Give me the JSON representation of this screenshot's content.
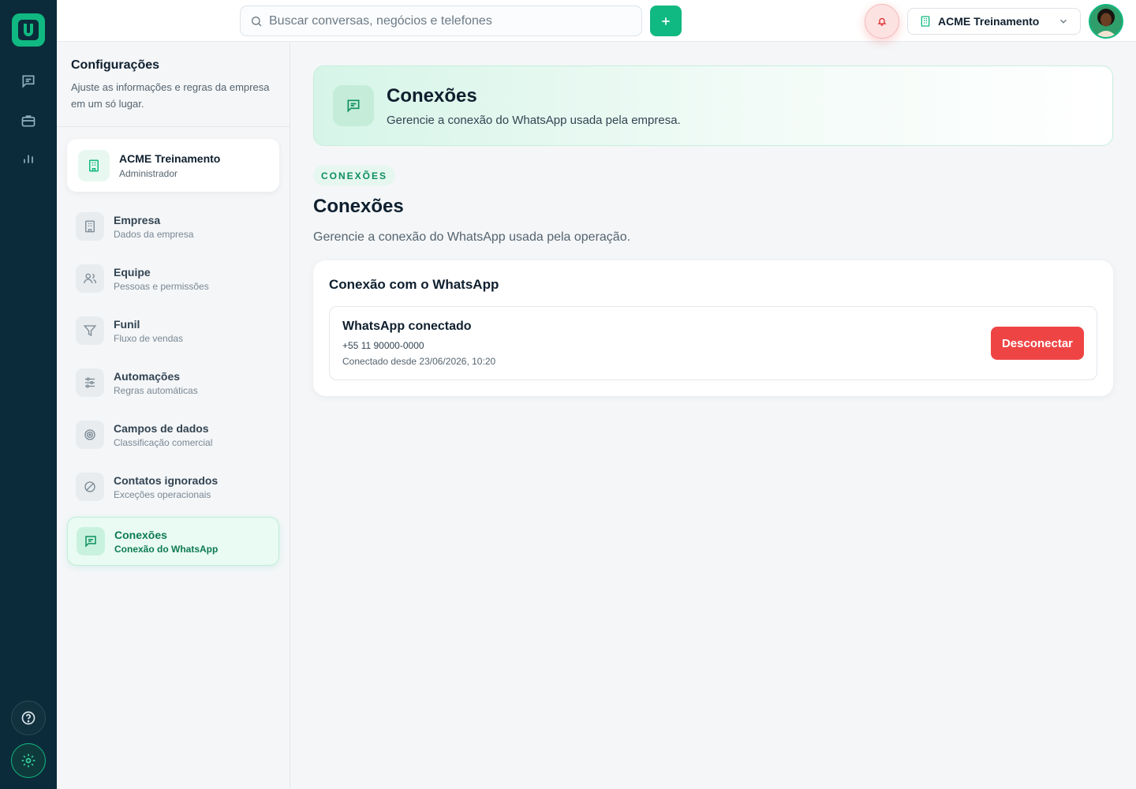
{
  "colors": {
    "brand": "#10b981",
    "rail": "#0c2b3a",
    "danger": "#ef4444"
  },
  "search": {
    "placeholder": "Buscar conversas, negócios e telefones"
  },
  "topbar": {
    "company_name": "ACME Treinamento"
  },
  "sidebar": {
    "title": "Configurações",
    "description": "Ajuste as informações e regras da empresa em um só lugar.",
    "org": {
      "name": "ACME Treinamento",
      "role": "Administrador"
    },
    "items": [
      {
        "label": "Empresa",
        "sub": "Dados da empresa",
        "icon": "building-icon"
      },
      {
        "label": "Equipe",
        "sub": "Pessoas e permissões",
        "icon": "users-icon"
      },
      {
        "label": "Funil",
        "sub": "Fluxo de vendas",
        "icon": "funnel-icon"
      },
      {
        "label": "Automações",
        "sub": "Regras automáticas",
        "icon": "sliders-icon"
      },
      {
        "label": "Campos de dados",
        "sub": "Classificação comercial",
        "icon": "target-icon"
      },
      {
        "label": "Contatos ignorados",
        "sub": "Exceções operacionais",
        "icon": "ban-icon"
      },
      {
        "label": "Conexões",
        "sub": "Conexão do WhatsApp",
        "icon": "message-icon",
        "active": true
      }
    ]
  },
  "hero": {
    "title": "Conexões",
    "description": "Gerencie a conexão do WhatsApp usada pela empresa."
  },
  "section": {
    "tag": "CONEXÕES",
    "title": "Conexões",
    "description": "Gerencie a conexão do WhatsApp usada pela operação."
  },
  "card": {
    "title": "Conexão com o WhatsApp",
    "status": "WhatsApp conectado",
    "phone": "+55 11 90000-0000",
    "since": "Conectado desde 23/06/2026, 10:20",
    "disconnect_label": "Desconectar"
  }
}
